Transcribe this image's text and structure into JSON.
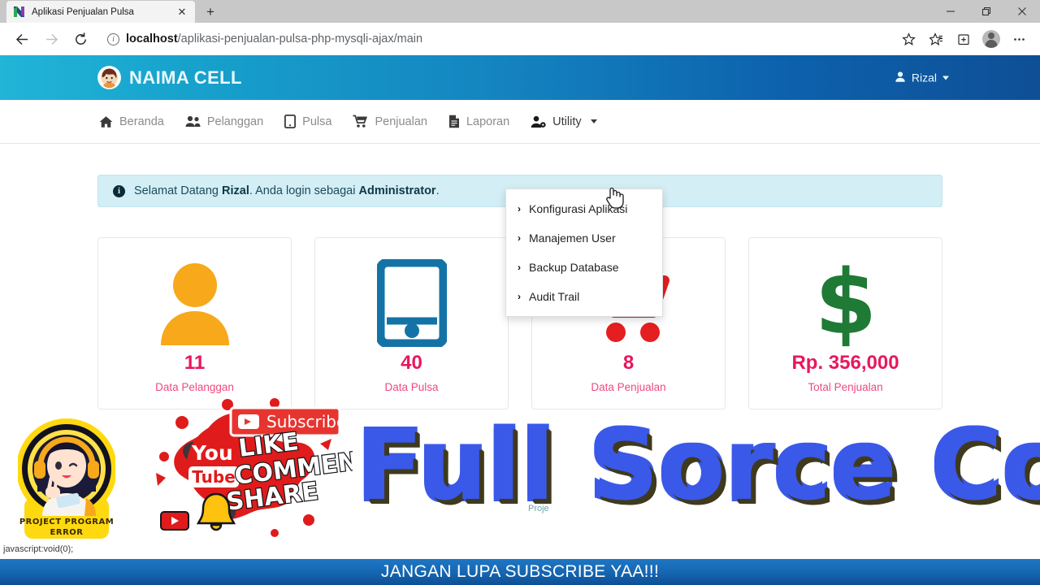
{
  "browser": {
    "tab": {
      "title": "Aplikasi Penjualan Pulsa",
      "favicon_icon": "netbeans-n-icon",
      "close_icon": "close-icon"
    },
    "new_tab_label": "+",
    "window_controls": [
      {
        "name": "minimize-button",
        "glyph": "minimize-icon"
      },
      {
        "name": "restore-button",
        "glyph": "restore-icon"
      },
      {
        "name": "close-window-button",
        "glyph": "close-icon"
      }
    ],
    "nav": {
      "back_icon": "back-arrow-icon",
      "forward_icon": "forward-arrow-icon",
      "reload_icon": "reload-icon"
    },
    "omnibox": {
      "info_icon": "info-icon",
      "url_host": "localhost",
      "url_path": "/aplikasi-penjualan-pulsa-php-mysqli-ajax/main"
    },
    "toolbar_icons": [
      {
        "name": "favorite-star-icon"
      },
      {
        "name": "favorites-bar-icon"
      },
      {
        "name": "collections-icon"
      },
      {
        "name": "profile-avatar"
      },
      {
        "name": "settings-more-icon",
        "glyph": "⋯"
      }
    ]
  },
  "app": {
    "brand": {
      "logo_icon": "naima-cell-logo",
      "name": "NAIMA CELL"
    },
    "user": {
      "icon": "user-icon",
      "name": "Rizal",
      "caret": "chevron-down-icon"
    },
    "nav_items": [
      {
        "label": "Beranda",
        "icon": "home-icon"
      },
      {
        "label": "Pelanggan",
        "icon": "users-icon"
      },
      {
        "label": "Pulsa",
        "icon": "tablet-icon"
      },
      {
        "label": "Penjualan",
        "icon": "cart-icon"
      },
      {
        "label": "Laporan",
        "icon": "report-icon"
      },
      {
        "label": "Utility",
        "icon": "user-gear-icon",
        "caret": "chevron-down-icon"
      }
    ],
    "dropdown": {
      "open": true,
      "items": [
        {
          "label": "Konfigurasi Aplikasi",
          "chevron": "›"
        },
        {
          "label": "Manajemen User",
          "chevron": "›"
        },
        {
          "label": "Backup Database",
          "chevron": "›"
        },
        {
          "label": "Audit Trail",
          "chevron": "›"
        }
      ]
    },
    "alert": {
      "icon": "info-icon",
      "prefix": "Selamat Datang ",
      "user": "Rizal",
      "middle": ". Anda login sebagai ",
      "role": "Administrator",
      "suffix": "."
    },
    "cards": [
      {
        "value": "11",
        "label": "Data Pelanggan",
        "icon": "person-icon",
        "color": "#f5a623"
      },
      {
        "value": "40",
        "label": "Data Pulsa",
        "icon": "tablet-icon",
        "color": "#1473a6"
      },
      {
        "value": "8",
        "label": "Data Penjualan",
        "icon": "shopping-cart-icon",
        "color": "#e51e20"
      },
      {
        "value": "Rp. 356,000",
        "label": "Total Penjualan",
        "icon": "dollar-icon",
        "color": "#1e7a35"
      }
    ],
    "status_bar_text": "javascript:void(0);"
  },
  "overlays": {
    "channel_logo": {
      "name": "project-program-error-logo",
      "line1": "PROJECT PROGRAM",
      "line2": "ERROR"
    },
    "subscribe_graphic": {
      "subscribe_label": "Subscribe",
      "youtube_you": "You",
      "youtube_tube": "Tube",
      "like": "LIKE",
      "comment": "COMMENT",
      "share": "SHARE"
    },
    "big_text": "Full Sorce Code",
    "watermark": "Proje",
    "bottom_banner": "JANGAN LUPA SUBSCRIBE YAA!!!"
  },
  "colors": {
    "header_gradient_start": "#22b5d8",
    "header_gradient_end": "#0e4f96",
    "accent_pink": "#e8175d",
    "alert_bg": "#d4eef6",
    "banner_blue": "#1565b0",
    "bigtext_blue": "#3a59e8"
  }
}
